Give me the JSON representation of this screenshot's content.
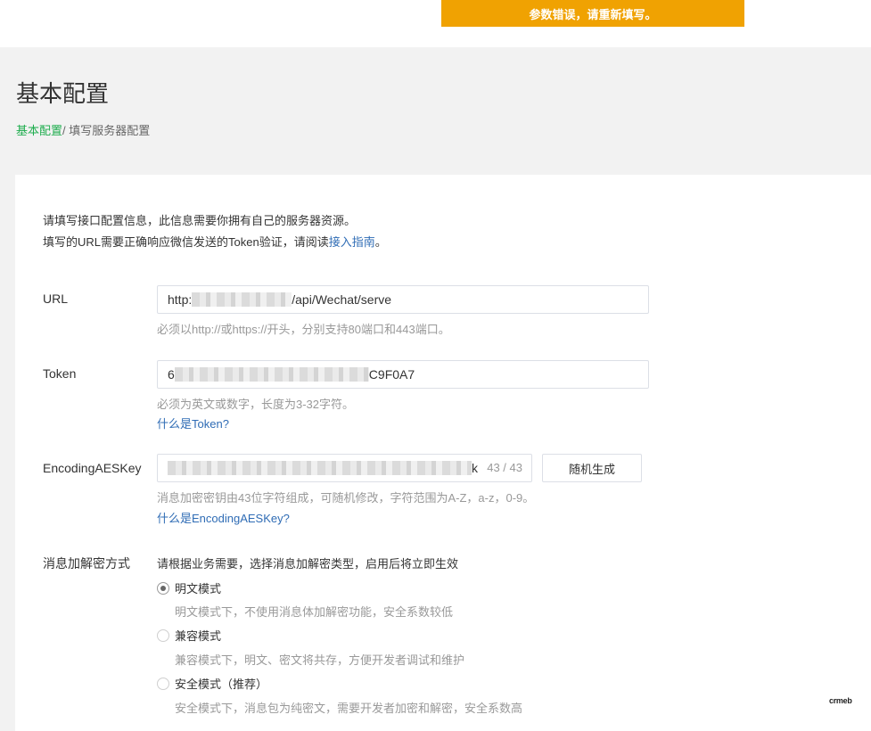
{
  "toast": {
    "text": "参数错误，请重新填写。"
  },
  "header": {
    "title": "基本配置"
  },
  "breadcrumb": {
    "root": "基本配置",
    "separator": "/ ",
    "current": "填写服务器配置"
  },
  "intro": {
    "line1": "请填写接口配置信息，此信息需要你拥有自己的服务器资源。",
    "line2_prefix": "填写的URL需要正确响应微信发送的Token验证，请阅读",
    "line2_link": "接入指南",
    "line2_suffix": "。"
  },
  "url": {
    "label": "URL",
    "value_prefix": "http:",
    "value_suffix": "/api/Wechat/serve",
    "hint": "必须以http://或https://开头，分别支持80端口和443端口。"
  },
  "token": {
    "label": "Token",
    "value_prefix": "6",
    "value_suffix": "C9F0A7",
    "hint": "必须为英文或数字，长度为3-32字符。",
    "help_link": "什么是Token?"
  },
  "aes": {
    "label": "EncodingAESKey",
    "value_suffix": "k",
    "counter": "43 / 43",
    "random_button": "随机生成",
    "hint": "消息加密密钥由43位字符组成，可随机修改，字符范围为A-Z，a-z，0-9。",
    "help_link": "什么是EncodingAESKey?"
  },
  "encryption": {
    "label": "消息加解密方式",
    "description": "请根据业务需要，选择消息加解密类型，启用后将立即生效",
    "options": [
      {
        "label": "明文模式",
        "desc": "明文模式下，不使用消息体加解密功能，安全系数较低",
        "checked": true
      },
      {
        "label": "兼容模式",
        "desc": "兼容模式下，明文、密文将共存，方便开发者调试和维护",
        "checked": false
      },
      {
        "label": "安全模式（推荐）",
        "desc": "安全模式下，消息包为纯密文，需要开发者加密和解密，安全系数高",
        "checked": false
      }
    ]
  },
  "watermark": {
    "text": "crmeb"
  },
  "colors": {
    "accent": "#1fad4e",
    "toast": "#f0a202",
    "link": "#2f6cb5"
  }
}
